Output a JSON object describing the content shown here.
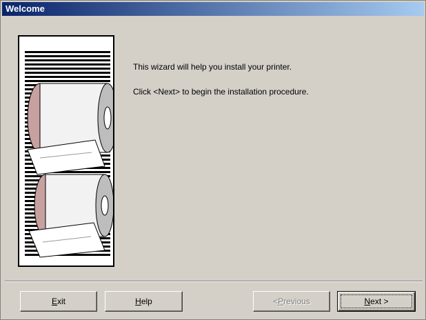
{
  "window": {
    "title": "Welcome"
  },
  "content": {
    "line1": "This wizard will help you install your printer.",
    "line2": "Click <Next> to begin the installation procedure."
  },
  "buttons": {
    "exit": {
      "mnemonic": "E",
      "rest": "xit"
    },
    "help": {
      "mnemonic": "H",
      "rest": "elp"
    },
    "previous": {
      "prefix": "< ",
      "mnemonic": "P",
      "rest": "revious"
    },
    "next": {
      "mnemonic": "N",
      "rest": "ext >"
    }
  },
  "colors": {
    "title_bar_start": "#0a246a",
    "title_bar_end": "#a6caf0",
    "dialog_face": "#d4d0c8"
  }
}
